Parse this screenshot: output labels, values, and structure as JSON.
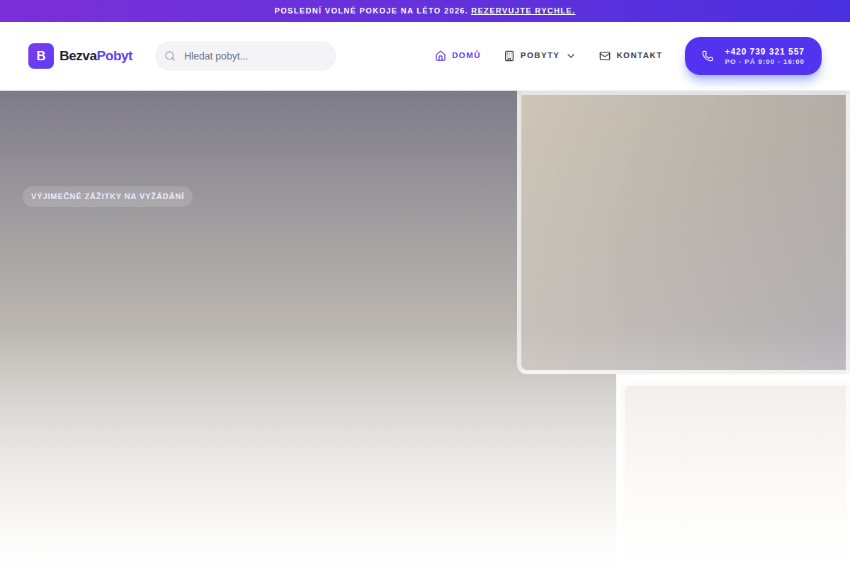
{
  "banner": {
    "text": "POSLEDNÍ VOLNÉ POKOJE NA LÉTO 2026.",
    "link": "REZERVUJTE RYCHLE."
  },
  "logo": {
    "letter": "B",
    "first": "Bezva",
    "second": "Pobyt"
  },
  "search": {
    "placeholder": "Hledat pobyt..."
  },
  "nav": [
    {
      "label": "DOMŮ",
      "selected": true,
      "icon": "home",
      "dropdown": false
    },
    {
      "label": "POBYTY",
      "selected": false,
      "icon": "building",
      "dropdown": true
    },
    {
      "label": "KONTAKT",
      "selected": false,
      "icon": "mail",
      "dropdown": false
    }
  ],
  "phone": {
    "number": "+420 739 321 557",
    "hours": "PO - PÁ 9:00 - 16:00"
  },
  "hero": {
    "badge": "VÝJIMEČNÉ ZÁŽITKY NA VYŽÁDÁNÍ"
  }
}
